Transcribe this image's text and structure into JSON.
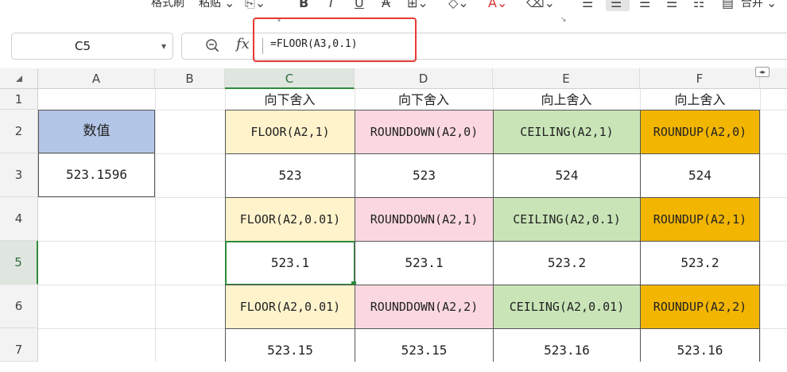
{
  "toolbar": {
    "format_painter": "格式刷",
    "paste": "粘贴",
    "merge": "合并"
  },
  "formula_bar": {
    "cell_ref": "C5",
    "formula": "=FLOOR(A3,0.1)"
  },
  "columns": [
    "A",
    "B",
    "C",
    "D",
    "E",
    "F"
  ],
  "rows": [
    "1",
    "2",
    "3",
    "4",
    "5",
    "6",
    "7"
  ],
  "active_cell": {
    "col": "C",
    "row": "5"
  },
  "sheet": {
    "headers": [
      "向下舍入",
      "向下舍入",
      "向上舍入",
      "向上舍入"
    ],
    "a2": "数值",
    "a3": "523.1596",
    "formula_rows": [
      [
        "FLOOR(A2,1)",
        "ROUNDDOWN(A2,0)",
        "CEILING(A2,1)",
        "ROUNDUP(A2,0)"
      ],
      [
        "FLOOR(A2,0.01)",
        "ROUNDDOWN(A2,1)",
        "CEILING(A2,0.1)",
        "ROUNDUP(A2,1)"
      ],
      [
        "FLOOR(A2,0.01)",
        "ROUNDDOWN(A2,2)",
        "CEILING(A2,0.01)",
        "ROUNDUP(A2,2)"
      ]
    ],
    "value_rows": [
      [
        "523",
        "523",
        "524",
        "524"
      ],
      [
        "523.1",
        "523.1",
        "523.2",
        "523.2"
      ],
      [
        "523.15",
        "523.15",
        "523.16",
        "523.16"
      ]
    ]
  },
  "colors": {
    "floor_fill": "#fff3cc",
    "rounddown_fill": "#fbd8df",
    "ceiling_fill": "#c9e5b8",
    "roundup_fill": "#f2b500",
    "label_fill": "#b4c6e7",
    "highlight_box": "#e53935",
    "active": "#2e8b3a"
  }
}
